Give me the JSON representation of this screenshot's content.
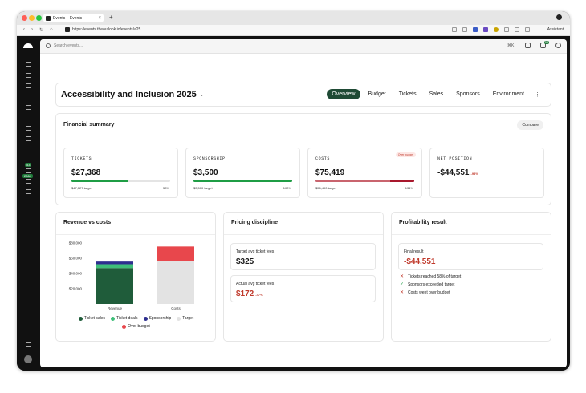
{
  "browser": {
    "tab_title": "Events – Events",
    "new_tab": "+",
    "url": "https://events.theoutlook.io/events/a25",
    "assistant_label": "Assistant"
  },
  "sidebar": {
    "badges": [
      "53",
      "2864"
    ]
  },
  "topbar": {
    "search_placeholder": "Search events...",
    "shortcut": "⌘K",
    "notification_count": "53"
  },
  "event": {
    "title": "Accessibility and Inclusion 2025",
    "tabs": [
      {
        "label": "Overview",
        "active": true
      },
      {
        "label": "Budget",
        "active": false
      },
      {
        "label": "Tickets",
        "active": false
      },
      {
        "label": "Sales",
        "active": false
      },
      {
        "label": "Sponsors",
        "active": false
      },
      {
        "label": "Environment",
        "active": false
      }
    ],
    "more": "⋮"
  },
  "financial_summary": {
    "title": "Financial summary",
    "compare_label": "Compare",
    "metrics": [
      {
        "label": "TICKETS",
        "value": "$27,368",
        "target": "$47,127 target",
        "pct_label": "58%",
        "fill": 0.58,
        "color": "#1f9d45"
      },
      {
        "label": "SPONSORSHIP",
        "value": "$3,500",
        "target": "$3,500 target",
        "pct_label": "100%",
        "fill": 1.0,
        "color": "#1f9d45"
      },
      {
        "label": "COSTS",
        "value": "$75,419",
        "target": "$56,490 target",
        "pct_label": "134%",
        "fill": 1.0,
        "color": "#c9646e",
        "over_fill_start": 0.76,
        "over_color": "#a8182d",
        "badge": "Over budget"
      }
    ],
    "net_position": {
      "label": "NET POSITION",
      "value": "-$44,551",
      "delta": "-98%"
    }
  },
  "revenue_vs_costs": {
    "title": "Revenue vs costs"
  },
  "chart_data": {
    "type": "bar",
    "categories": [
      "Revenue",
      "Costs"
    ],
    "ylim": [
      0,
      80000
    ],
    "yticks": [
      0,
      20000,
      40000,
      60000,
      80000
    ],
    "ytick_labels": [
      "",
      "$20,000",
      "$40,000",
      "$60,000",
      "$80,000"
    ],
    "series": [
      {
        "name": "Ticket sales",
        "color": "#1f5c3a",
        "values": [
          47127,
          0
        ]
      },
      {
        "name": "Ticket deals",
        "color": "#3fbf79",
        "values": [
          5000,
          0
        ]
      },
      {
        "name": "Sponsorship",
        "color": "#2e2f8f",
        "values": [
          3500,
          0
        ]
      },
      {
        "name": "Target",
        "color": "#e3e3e3",
        "values": [
          0,
          56490
        ]
      },
      {
        "name": "Over budget",
        "color": "#e8474c",
        "values": [
          0,
          18929
        ]
      }
    ]
  },
  "pricing": {
    "title": "Pricing discipline",
    "target_label": "Target avg ticket fees",
    "target_value": "$325",
    "actual_label": "Actual avg ticket fees",
    "actual_value": "$172",
    "actual_delta": "-47%"
  },
  "profitability": {
    "title": "Profitability result",
    "final_label": "Final result",
    "final_value": "-$44,551",
    "items": [
      {
        "text": "Tickets reached 58% of target",
        "status": "bad"
      },
      {
        "text": "Sponsors exceeded target",
        "status": "good"
      },
      {
        "text": "Costs went over budget",
        "status": "bad"
      }
    ]
  },
  "colors": {
    "accent": "#1f4a35",
    "good": "#1f9d45",
    "bad": "#c0392b"
  }
}
